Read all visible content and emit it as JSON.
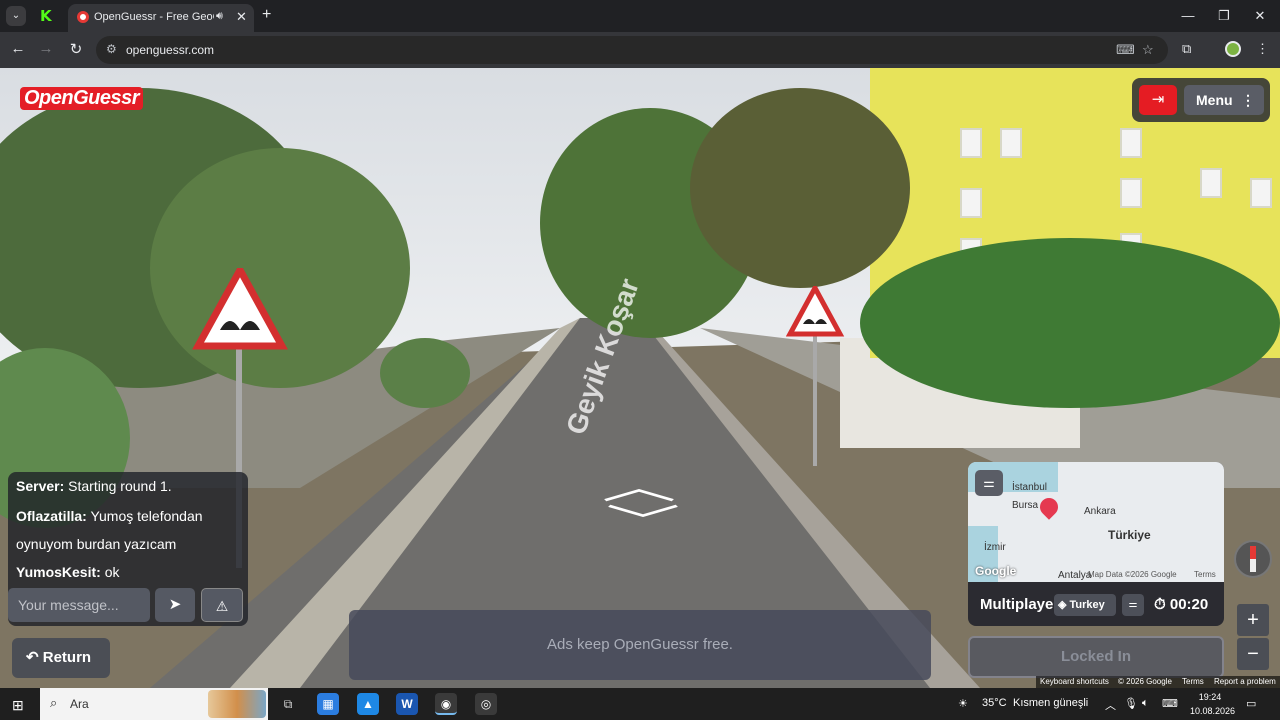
{
  "browser": {
    "tabs": [
      {
        "title": "OpenGuessr - Free GeoGuessr",
        "active": true
      }
    ],
    "url": "openguessr.com"
  },
  "game": {
    "logo": "OpenGuessr",
    "menu_label": "Menu",
    "road_label": "Geyik Koşar",
    "chat": {
      "messages": [
        {
          "sender": "Server:",
          "text": "Starting round 1."
        },
        {
          "sender": "Oflazatilla:",
          "text": "Yumoş telefondan"
        },
        {
          "sender": "",
          "text": "oynuyom burdan yazıcam"
        },
        {
          "sender": "YumosKesit:",
          "text": "ok"
        }
      ],
      "input_placeholder": "Your message..."
    },
    "return_label": "Return",
    "ad_text": "Ads keep OpenGuessr free.",
    "map": {
      "cities": {
        "istanbul": "İstanbul",
        "bursa": "Bursa",
        "ankara": "Ankara",
        "turkiye": "Türkiye",
        "izmir": "İzmir",
        "antalya": "Antalya"
      },
      "google": "Google",
      "map_data": "Map Data ©2026 Google",
      "terms": "Terms"
    },
    "mode_label": "Multiplayer",
    "country_tag": "Turkey",
    "timer": "00:20",
    "lock_in_label": "Locked In",
    "footer": {
      "shortcuts": "Keyboard shortcuts",
      "copyright": "© 2026 Google",
      "terms": "Terms",
      "report": "Report a problem"
    }
  },
  "taskbar": {
    "search_placeholder": "Ara",
    "weather": "35°C",
    "weather_desc": "Kısmen güneşli",
    "time": "19:24",
    "date": "10.08.2026"
  }
}
